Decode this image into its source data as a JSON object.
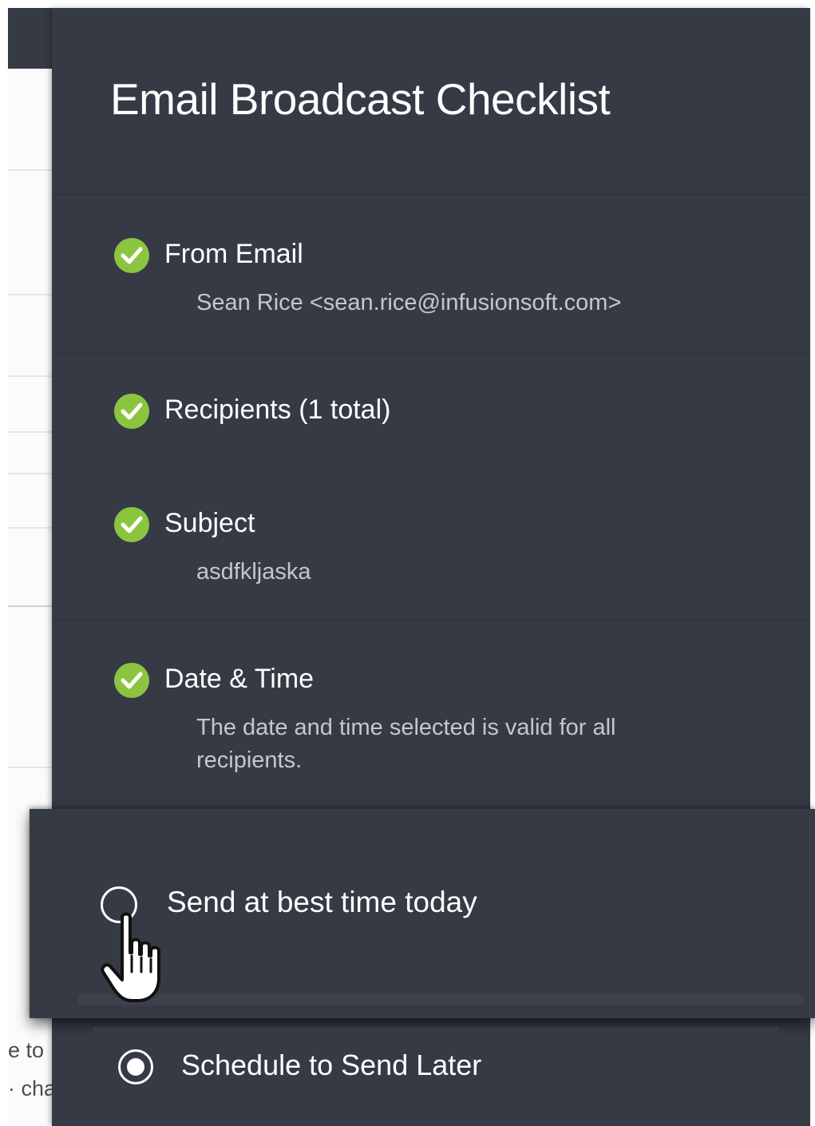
{
  "background_page": {
    "snippet_line_1": "e to",
    "snippet_line_2": "· cha"
  },
  "checklist": {
    "title": "Email Broadcast Checklist",
    "items": [
      {
        "label": "From Email",
        "detail": "Sean Rice <sean.rice@infusionsoft.com>",
        "status": "complete"
      },
      {
        "label": "Recipients (1 total)",
        "detail": "",
        "status": "complete"
      },
      {
        "label": "Subject",
        "detail": "asdfkljaska",
        "status": "complete"
      },
      {
        "label": "Date & Time",
        "detail": "The date and time selected is valid for all recipients.",
        "status": "complete"
      }
    ]
  },
  "send_options": {
    "best_time": {
      "label": "Send at best time today",
      "selected": false
    },
    "schedule_later": {
      "label": "Schedule to Send Later",
      "selected": true
    }
  },
  "colors": {
    "panel": "#363a45",
    "check": "#8bc53f",
    "text": "#ffffff",
    "detail_text": "#c4c7ce"
  },
  "icons": {
    "check": "check-circle-icon",
    "radio_unselected": "radio-unselected-icon",
    "radio_selected": "radio-selected-icon",
    "cursor": "hand-pointer-icon"
  }
}
